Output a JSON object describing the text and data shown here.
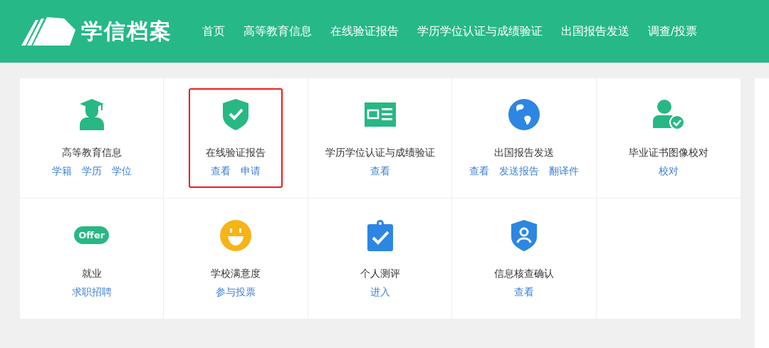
{
  "header": {
    "logo_text": "学信档案",
    "nav": [
      {
        "label": "首页"
      },
      {
        "label": "高等教育信息"
      },
      {
        "label": "在线验证报告"
      },
      {
        "label": "学历学位认证与成绩验证"
      },
      {
        "label": "出国报告发送"
      },
      {
        "label": "调查/投票"
      }
    ]
  },
  "tiles": [
    {
      "kind": "graduate",
      "title": "高等教育信息",
      "links": [
        "学籍",
        "学历",
        "学位"
      ],
      "highlighted": false
    },
    {
      "kind": "shield-check",
      "title": "在线验证报告",
      "links": [
        "查看",
        "申请"
      ],
      "highlighted": true
    },
    {
      "kind": "id-card",
      "title": "学历学位认证与成绩验证",
      "links": [
        "查看"
      ],
      "highlighted": false
    },
    {
      "kind": "globe",
      "title": "出国报告发送",
      "links": [
        "查看",
        "发送报告",
        "翻译件"
      ],
      "highlighted": false
    },
    {
      "kind": "person-check",
      "title": "毕业证书图像校对",
      "links": [
        "校对"
      ],
      "highlighted": false
    },
    {
      "kind": "offer",
      "badge": "Offer",
      "title": "就业",
      "links": [
        "求职招聘"
      ],
      "highlighted": false
    },
    {
      "kind": "smiley",
      "title": "学校满意度",
      "links": [
        "参与投票"
      ],
      "highlighted": false
    },
    {
      "kind": "clipboard",
      "title": "个人测评",
      "links": [
        "进入"
      ],
      "highlighted": false
    },
    {
      "kind": "shield-person",
      "title": "信息核查确认",
      "links": [
        "查看"
      ],
      "highlighted": false
    }
  ]
}
